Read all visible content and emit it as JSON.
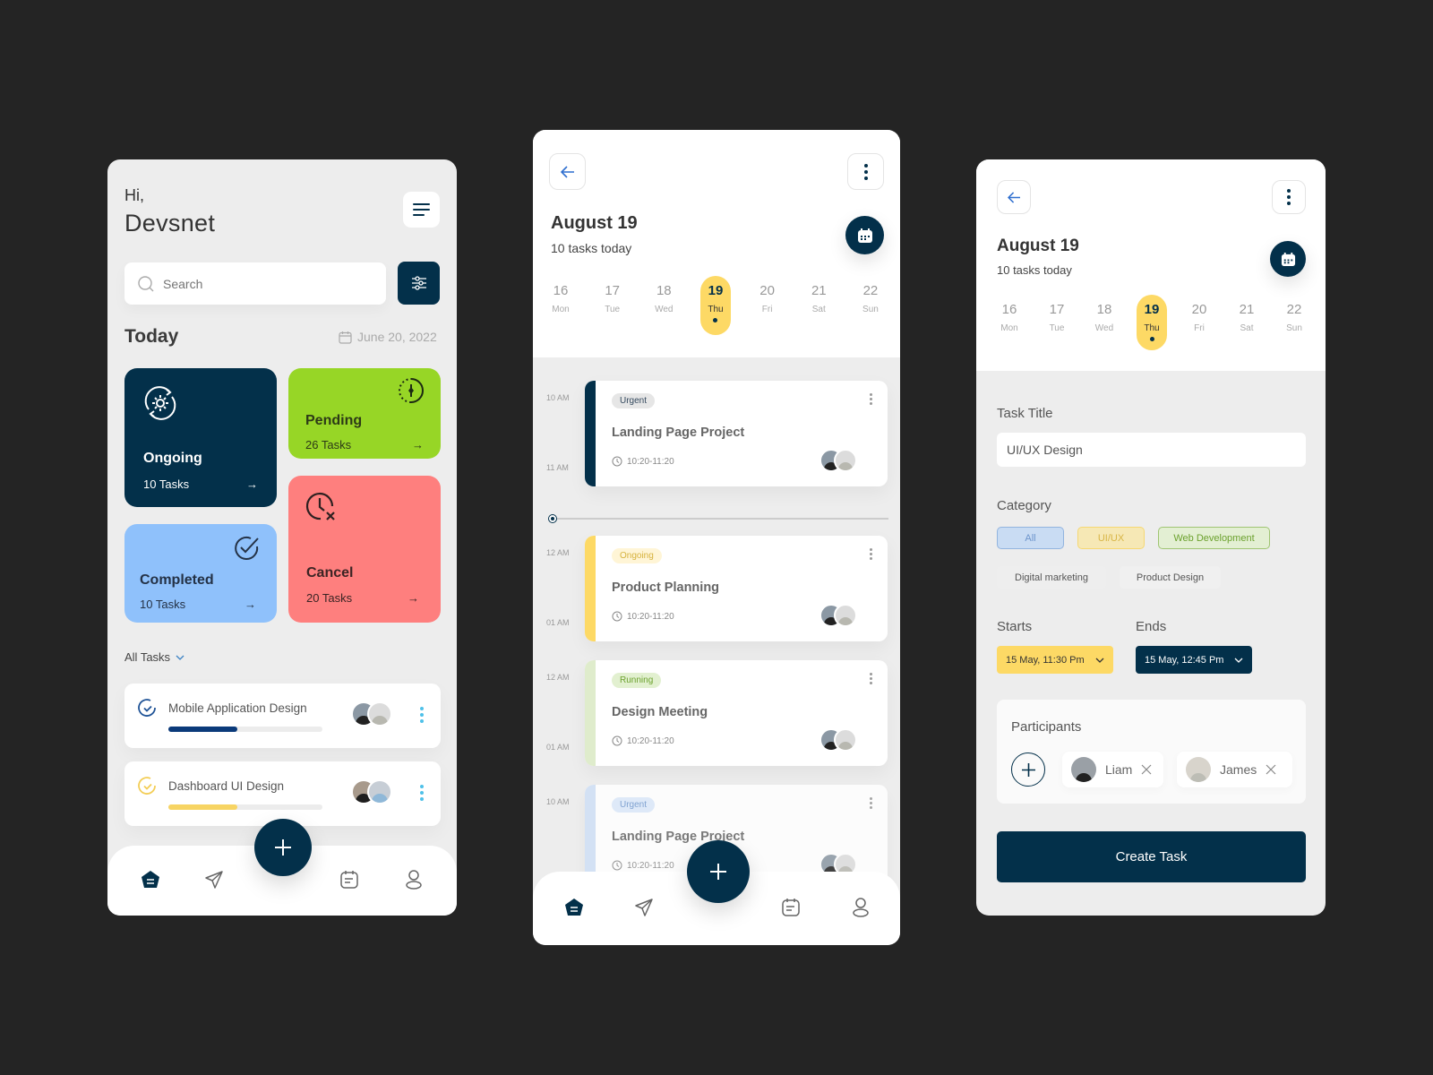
{
  "screen_home": {
    "greeting": "Hi,",
    "user_name": "Devsnet",
    "search": {
      "placeholder": "Search",
      "value": ""
    },
    "section_title": "Today",
    "date": "June 20, 2022",
    "stats": [
      {
        "label": "Ongoing",
        "count": "10 Tasks",
        "icon": "gear-sync-icon",
        "color": "#03304a"
      },
      {
        "label": "Pending",
        "count": "26 Tasks",
        "icon": "clock-pending-icon",
        "color": "#97d626"
      },
      {
        "label": "Completed",
        "count": "10 Tasks",
        "icon": "check-circle-icon",
        "color": "#8fc1fb"
      },
      {
        "label": "Cancel",
        "count": "20 Tasks",
        "icon": "clock-cancel-icon",
        "color": "#fe7f7e"
      }
    ],
    "filter_label": "All Tasks",
    "tasks": [
      {
        "title": "Mobile Application Design",
        "progress": 0.45,
        "color": "#0b3a7a"
      },
      {
        "title": "Dashboard UI Design",
        "progress": 0.45,
        "color": "#f7d463"
      }
    ],
    "nav": [
      "home-icon",
      "send-icon",
      "calendar-note-icon",
      "profile-icon"
    ]
  },
  "screen_schedule": {
    "date_title": "August 19",
    "subtitle": "10 tasks today",
    "days": [
      {
        "num": "16",
        "wd": "Mon"
      },
      {
        "num": "17",
        "wd": "Tue"
      },
      {
        "num": "18",
        "wd": "Wed"
      },
      {
        "num": "19",
        "wd": "Thu",
        "selected": true
      },
      {
        "num": "20",
        "wd": "Fri"
      },
      {
        "num": "21",
        "wd": "Sat"
      },
      {
        "num": "22",
        "wd": "Sun"
      }
    ],
    "events": [
      {
        "badge": "Urgent",
        "title": "Landing Page Project",
        "time": "10:20-11:20",
        "start": "10 AM",
        "end": "11 AM",
        "stripe": "#03304a",
        "badge_bg": "#e6e6e6",
        "badge_fg": "#34495e"
      },
      {
        "badge": "Ongoing",
        "title": "Product Planning",
        "time": "10:20-11:20",
        "start": "12 AM",
        "end": "01 AM",
        "stripe": "#fdd965",
        "badge_bg": "#fff5d6",
        "badge_fg": "#d6b23d"
      },
      {
        "badge": "Running",
        "title": "Design Meeting",
        "time": "10:20-11:20",
        "start": "12 AM",
        "end": "01 AM",
        "stripe": "#dfeccc",
        "badge_bg": "#e2f0d0",
        "badge_fg": "#6ca22e"
      },
      {
        "badge": "Urgent",
        "title": "Landing Page Project",
        "time": "10:20-11:20",
        "start": "10 AM",
        "end": "",
        "stripe": "#cfe0f6",
        "badge_bg": "#dce9fa",
        "badge_fg": "#6d95cc"
      }
    ]
  },
  "screen_create": {
    "date_title": "August 19",
    "subtitle": "10 tasks today",
    "task_title_label": "Task Title",
    "task_title_value": "UI/UX Design",
    "category_label": "Category",
    "categories": [
      "All",
      "UI/UX",
      "Web Development",
      "Digital marketing",
      "Product Design"
    ],
    "starts_label": "Starts",
    "starts_value": "15 May, 11:30 Pm",
    "ends_label": "Ends",
    "ends_value": "15 May, 12:45 Pm",
    "participants_label": "Participants",
    "participants": [
      "Liam",
      "James"
    ],
    "create_button": "Create Task"
  }
}
